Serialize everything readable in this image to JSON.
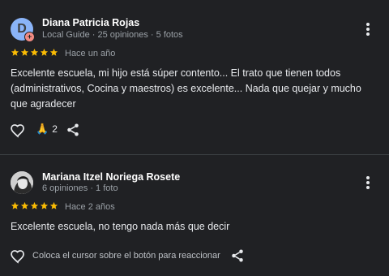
{
  "reviews": [
    {
      "author": "Diana Patricia Rojas",
      "avatar_letter": "D",
      "meta": "Local Guide · 25 opiniones · 5 fotos",
      "rating": 5,
      "time": "Hace un año",
      "text": "Excelente escuela, mi hijo está súper contento... El trato que tienen todos (administrativos, Cocina y maestros) es excelente... Nada que quejar y mucho que agradecer",
      "reaction_emoji": "🙏",
      "reaction_count": "2"
    },
    {
      "author": "Mariana Itzel Noriega Rosete",
      "meta": "6 opiniones · 1 foto",
      "rating": 5,
      "time": "Hace 2 años",
      "text": "Excelente escuela, no tengo nada más que decir",
      "hover_hint": "Coloca el cursor sobre el botón para reaccionar"
    }
  ],
  "colors": {
    "background": "#202124",
    "star": "#fbbc04",
    "secondary_text": "#9aa0a6",
    "avatar_blue": "#8ab4f8",
    "local_guide_badge": "#f28b82"
  },
  "icons": [
    "star-icon",
    "heart-outline-icon",
    "share-icon",
    "more-vert-icon",
    "local-guide-badge-icon",
    "praying-hands-emoji"
  ]
}
